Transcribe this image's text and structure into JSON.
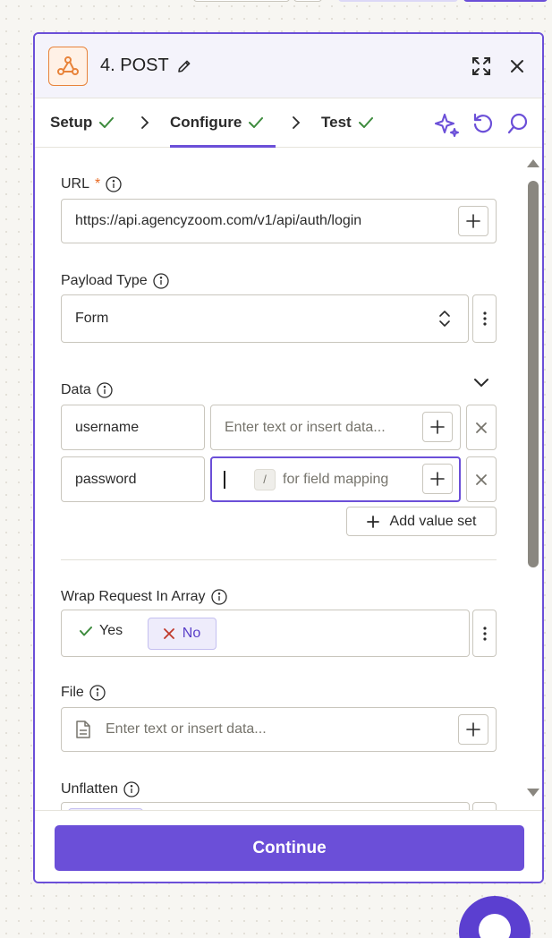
{
  "colors": {
    "accent": "#6b4fd8",
    "check": "#3d8b3d",
    "required": "#e86a23",
    "no_x": "#c0392b"
  },
  "step": {
    "title": "4. POST",
    "app_icon": "webhook-icon"
  },
  "tabs": [
    {
      "label": "Setup",
      "status": "check-icon"
    },
    {
      "label": "Configure",
      "status": "check-icon"
    },
    {
      "label": "Test",
      "status": "check-icon"
    }
  ],
  "form": {
    "url": {
      "label": "URL",
      "required_mark": "*",
      "value": "https://api.agencyzoom.com/v1/api/auth/login"
    },
    "payload_type": {
      "label": "Payload Type",
      "value": "Form"
    },
    "data": {
      "label": "Data",
      "rows": [
        {
          "key": "username",
          "placeholder": "Enter text or insert data..."
        },
        {
          "key": "password",
          "slash": "/",
          "hint": "for field mapping"
        }
      ],
      "add_label": "Add value set"
    },
    "wrap": {
      "label": "Wrap Request In Array",
      "yes": "Yes",
      "no": "No"
    },
    "file": {
      "label": "File",
      "placeholder": "Enter text or insert data..."
    },
    "unflatten": {
      "label": "Unflatten"
    }
  },
  "footer": {
    "continue_label": "Continue"
  }
}
